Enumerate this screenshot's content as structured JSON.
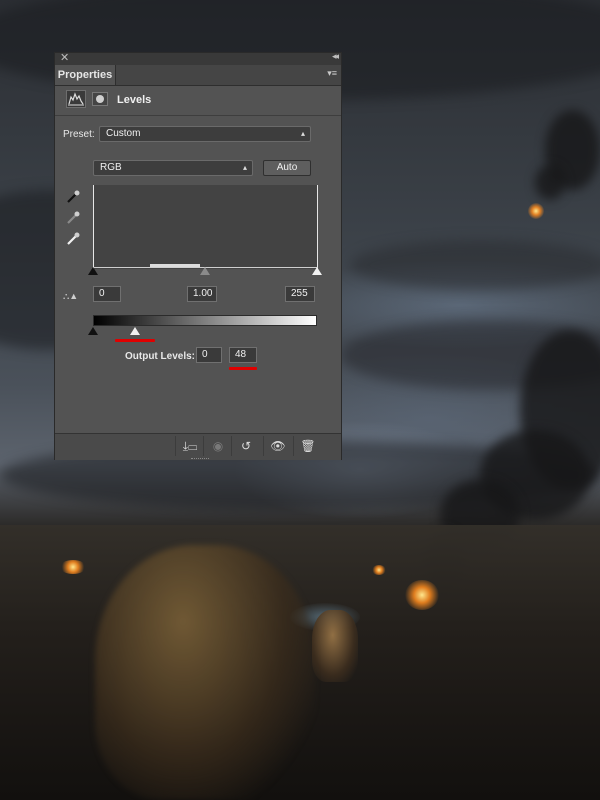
{
  "window": {
    "close_glyph": "✕",
    "collapse_glyph": "◂◂"
  },
  "panel": {
    "tab_label": "Properties",
    "menu_icon": "panel-menu-icon",
    "adjustment_label": "Levels",
    "preset_label": "Preset:",
    "preset_value": "Custom",
    "channel_value": "RGB",
    "auto_label": "Auto",
    "input_black": "0",
    "input_gamma": "1.00",
    "input_white": "255",
    "output_label": "Output Levels:",
    "output_black": "0",
    "output_white": "48",
    "output_white_fraction": 0.188
  },
  "icons": {
    "levels": "levels-histogram-icon",
    "mask": "layer-mask-icon",
    "eyedropper_black": "black-point-eyedropper-icon",
    "eyedropper_gray": "gray-point-eyedropper-icon",
    "eyedropper_white": "white-point-eyedropper-icon",
    "warning": "clipping-warning-icon",
    "clip": "clip-to-layer-icon",
    "view_previous": "view-previous-icon",
    "reset": "reset-icon",
    "visibility": "visibility-eye-icon",
    "delete": "trash-icon"
  },
  "colors": {
    "highlight": "#e00000",
    "panel_bg": "#535353"
  }
}
